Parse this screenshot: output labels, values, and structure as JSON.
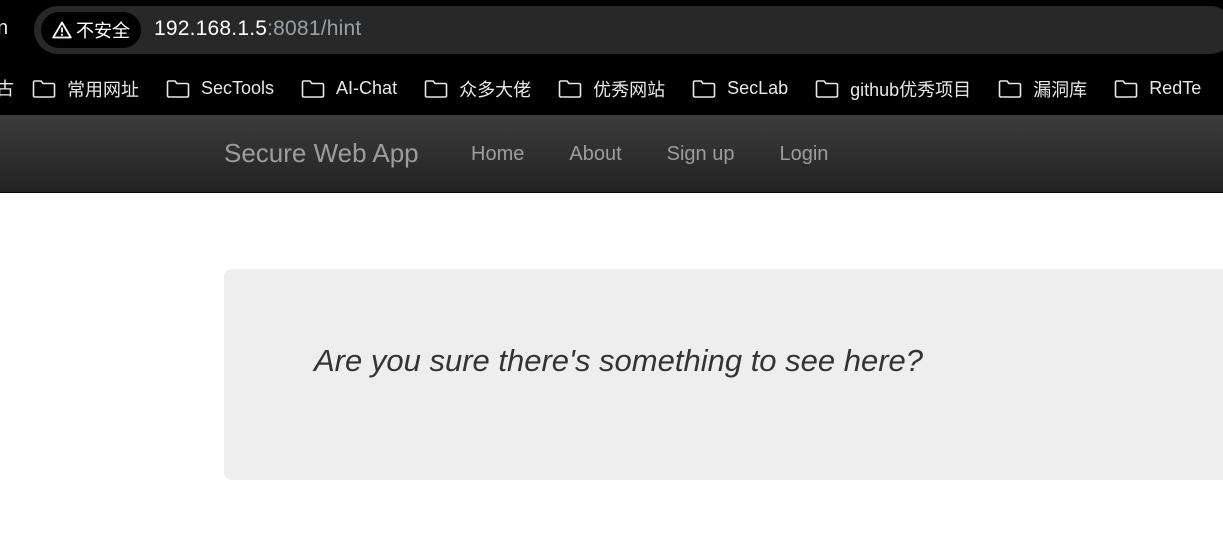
{
  "browser": {
    "security_label": "不安全",
    "url_host": "192.168.1.5",
    "url_rest": ":8081/hint",
    "left_edge_glyph": "n",
    "bookmarks_cut_label": "古",
    "bookmarks": [
      {
        "label": "常用网址",
        "icon": "folder-icon"
      },
      {
        "label": "SecTools",
        "icon": "folder-icon"
      },
      {
        "label": "AI-Chat",
        "icon": "folder-icon"
      },
      {
        "label": "众多大佬",
        "icon": "folder-icon"
      },
      {
        "label": "优秀网站",
        "icon": "folder-icon"
      },
      {
        "label": "SecLab",
        "icon": "folder-icon"
      },
      {
        "label": "github优秀项目",
        "icon": "folder-icon"
      },
      {
        "label": "漏洞库",
        "icon": "folder-icon"
      },
      {
        "label": "RedTe",
        "icon": "folder-icon"
      }
    ]
  },
  "site": {
    "brand": "Secure Web App",
    "nav": [
      {
        "label": "Home"
      },
      {
        "label": "About"
      },
      {
        "label": "Sign up"
      },
      {
        "label": "Login"
      }
    ],
    "hint_message": "Are you sure there's something to see here?"
  },
  "colors": {
    "chrome_background": "#000000",
    "address_bar": "#282828",
    "navbar_gradient_top": "#3c3c3c",
    "navbar_gradient_bottom": "#222222",
    "nav_text": "#9d9d9d",
    "jumbotron_background": "#eeeeee",
    "hint_text": "#333333"
  }
}
